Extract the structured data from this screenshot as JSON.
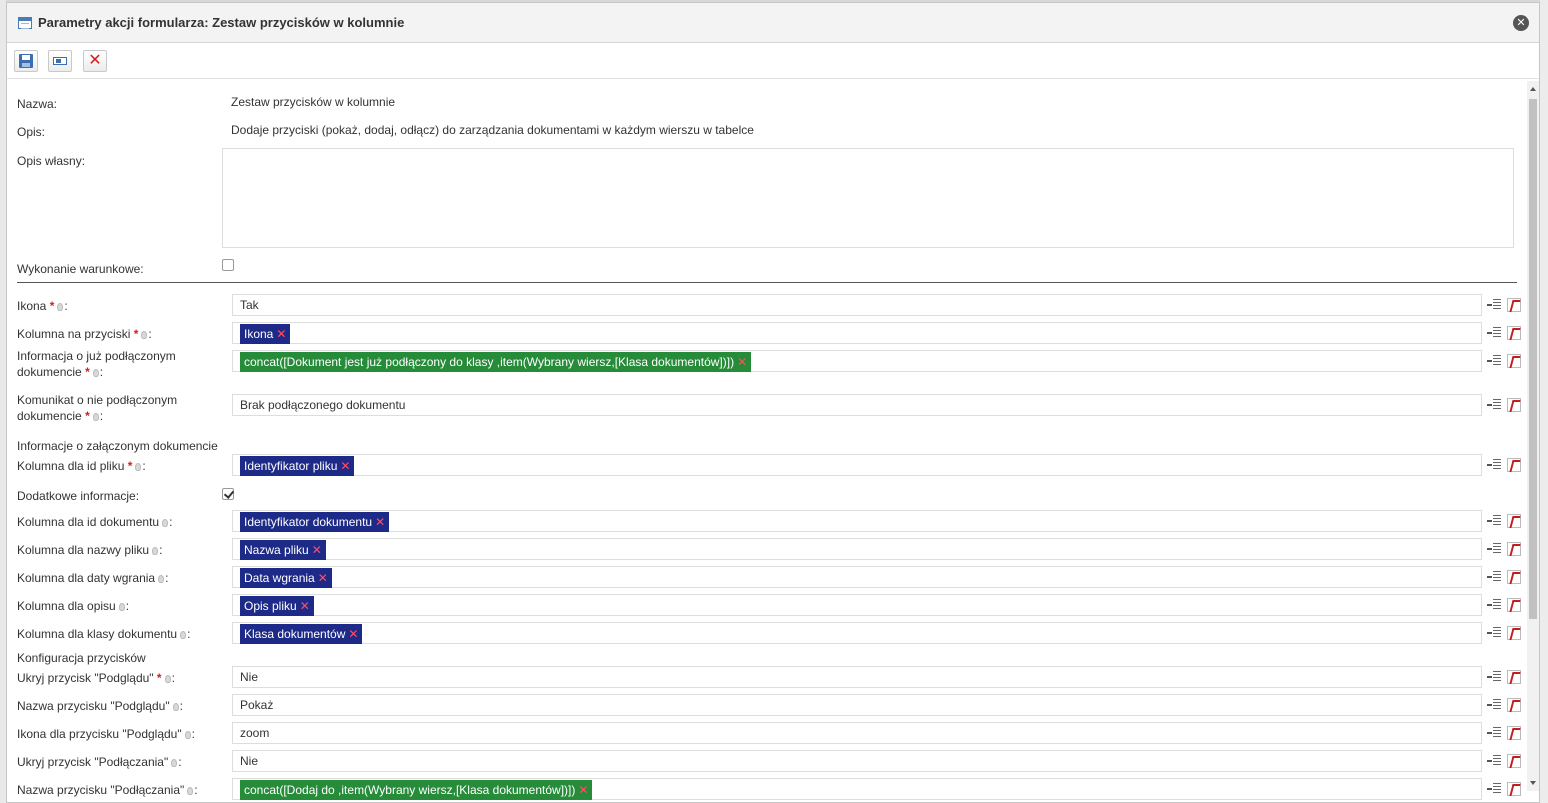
{
  "dialog": {
    "title": "Parametry akcji formularza: Zestaw przycisków w kolumnie",
    "close_symbol": "✕"
  },
  "toolbar": {
    "save_icon": "save-icon",
    "field_icon": "field-icon",
    "cancel_symbol": "✕"
  },
  "form": {
    "name_label": "Nazwa:",
    "name_value": "Zestaw przycisków w kolumnie",
    "desc_label": "Opis:",
    "desc_value": "Dodaje przyciski (pokaż, dodaj, odłącz) do zarządzania dokumentami w każdym wierszu w tabelce",
    "own_desc_label": "Opis własny:",
    "conditional_label": "Wykonanie warunkowe:",
    "conditional_checked": false,
    "req_mark": "*",
    "colon": ":",
    "chip_x": "✕",
    "fields": [
      {
        "label": "Ikona",
        "required": true,
        "type": "text",
        "value": "Tak"
      },
      {
        "label": "Kolumna na przyciski",
        "required": true,
        "type": "chip",
        "color": "navy",
        "value": "Ikona"
      },
      {
        "label": "Informacja o już podłączonym dokumencie",
        "required": true,
        "type": "chip",
        "color": "green",
        "value": "concat([Dokument jest już podłączony do klasy ,item(Wybrany wiersz,[Klasa dokumentów])])"
      },
      {
        "label": "Komunikat o nie podłączonym dokumencie",
        "required": true,
        "type": "text",
        "value": "Brak podłączonego dokumentu"
      }
    ],
    "section_attached": "Informacje o załączonym dokumencie",
    "fields_attached": [
      {
        "label": "Kolumna dla id pliku",
        "required": true,
        "type": "chip",
        "color": "navy",
        "value": "Identyfikator pliku"
      }
    ],
    "extra_label": "Dodatkowe informacje:",
    "extra_checked": true,
    "fields_extra": [
      {
        "label": "Kolumna dla id dokumentu",
        "type": "chip",
        "color": "navy",
        "value": "Identyfikator dokumentu"
      },
      {
        "label": "Kolumna dla nazwy pliku",
        "type": "chip",
        "color": "navy",
        "value": "Nazwa pliku"
      },
      {
        "label": "Kolumna dla daty wgrania",
        "type": "chip",
        "color": "navy",
        "value": "Data wgrania"
      },
      {
        "label": "Kolumna dla opisu",
        "type": "chip",
        "color": "navy",
        "value": "Opis pliku"
      },
      {
        "label": "Kolumna dla klasy dokumentu",
        "type": "chip",
        "color": "navy",
        "value": "Klasa dokumentów"
      }
    ],
    "section_buttons": "Konfiguracja przycisków",
    "fields_buttons": [
      {
        "label": "Ukryj przycisk \"Podglądu\"",
        "required": true,
        "type": "text",
        "value": "Nie"
      },
      {
        "label": "Nazwa przycisku \"Podglądu\"",
        "type": "text",
        "value": "Pokaż"
      },
      {
        "label": "Ikona dla przycisku \"Podglądu\"",
        "type": "text",
        "value": "zoom"
      },
      {
        "label": "Ukryj przycisk \"Podłączania\"",
        "type": "text",
        "value": "Nie"
      },
      {
        "label": "Nazwa przycisku \"Podłączania\"",
        "type": "chip",
        "color": "green",
        "value": "concat([Dodaj do ,item(Wybrany wiersz,[Klasa dokumentów])])"
      }
    ]
  },
  "colors": {
    "chip_navy": "#1d2a88",
    "chip_green": "#268c3a",
    "required": "#d21d1d"
  }
}
